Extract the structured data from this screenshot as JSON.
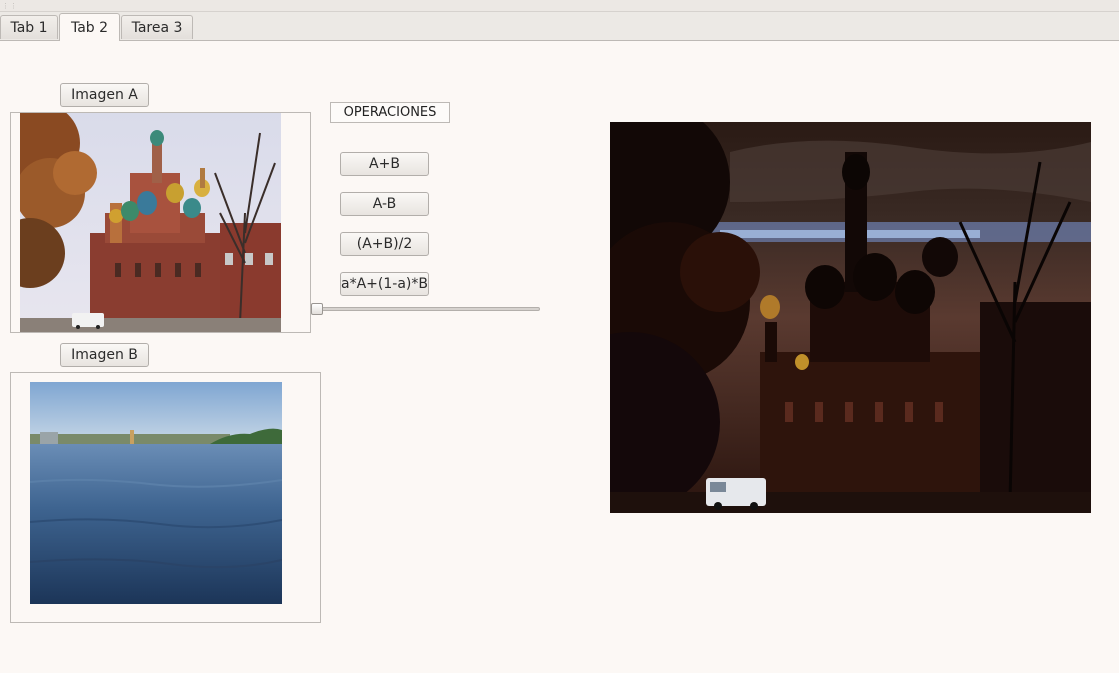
{
  "tabs": [
    {
      "label": "Tab 1"
    },
    {
      "label": "Tab 2"
    },
    {
      "label": "Tarea 3"
    }
  ],
  "active_tab": "Tab 2",
  "buttons": {
    "load_a": "Imagen A",
    "load_b": "Imagen B",
    "add": "A+B",
    "subtract": "A-B",
    "average": "(A+B)/2",
    "blend": "a*A+(1-a)*B"
  },
  "operations_label": "OPERACIONES",
  "slider": {
    "value": 0,
    "min": 0,
    "max": 100
  },
  "images": {
    "a": "cathedral-photo",
    "b": "river-photo",
    "result": "blended-result-photo"
  }
}
